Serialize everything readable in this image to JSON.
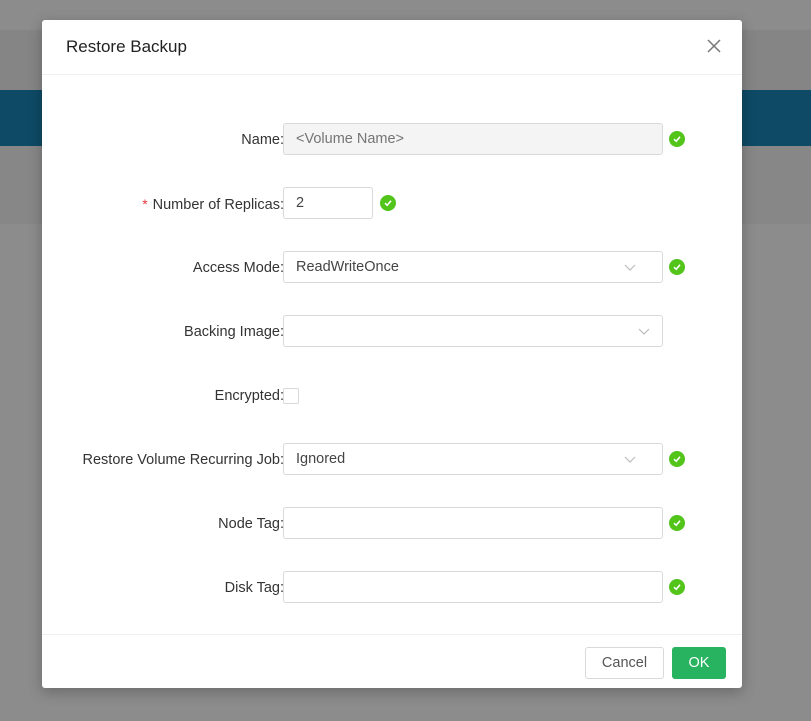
{
  "modal": {
    "title": "Restore Backup"
  },
  "form": {
    "name": {
      "label": "Name",
      "placeholder": "<Volume Name>",
      "value": ""
    },
    "replicas": {
      "label": "Number of Replicas",
      "required_mark": "*",
      "value": "2"
    },
    "access_mode": {
      "label": "Access Mode",
      "value": "ReadWriteOnce"
    },
    "backing_image": {
      "label": "Backing Image",
      "value": ""
    },
    "encrypted": {
      "label": "Encrypted",
      "checked": false
    },
    "recurring_job": {
      "label": "Restore Volume Recurring Job",
      "value": "Ignored"
    },
    "node_tag": {
      "label": "Node Tag",
      "value": ""
    },
    "disk_tag": {
      "label": "Disk Tag",
      "value": ""
    }
  },
  "footer": {
    "cancel_label": "Cancel",
    "ok_label": "OK"
  },
  "colors": {
    "accent_green": "#27b35f",
    "valid_check": "#52c41a",
    "required_red": "#e6373f",
    "header_band": "#1a87b8"
  },
  "icons": {
    "close": "close-icon",
    "valid": "check-circle-icon",
    "dropdown": "chevron-down-icon"
  }
}
